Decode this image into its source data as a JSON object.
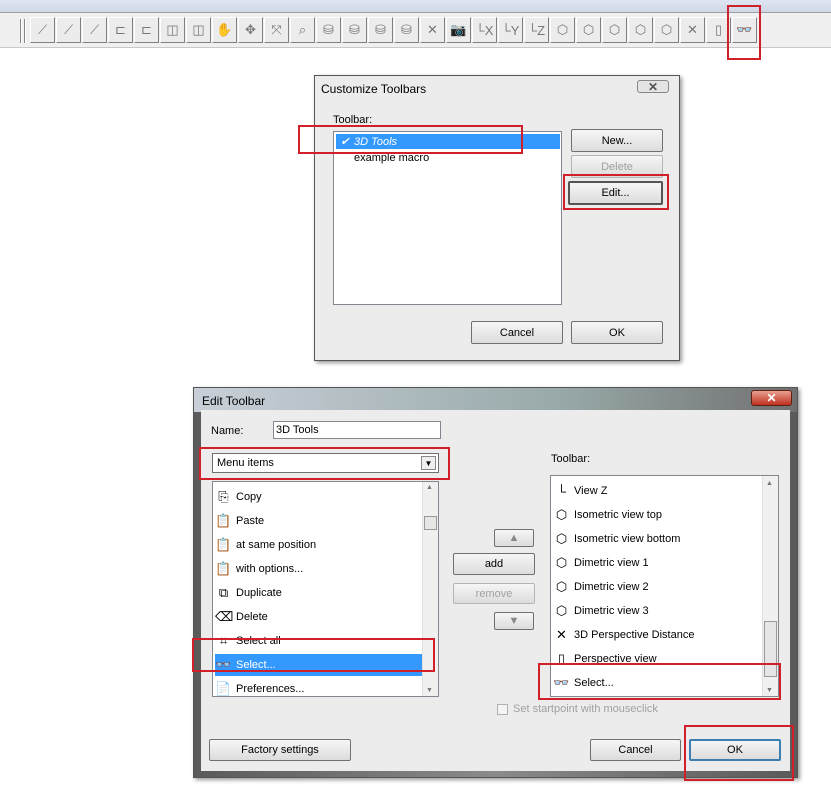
{
  "toolbar_icons": [
    "pointer-icon",
    "pointer-p-icon",
    "pointer-star-icon",
    "measure-rect-icon",
    "measure-curve-icon",
    "rect-shape-icon",
    "curve-shape-icon",
    "hand-pan-icon",
    "move-in-icon",
    "move-out-icon",
    "zoom-window-icon",
    "cylinder-icon",
    "cylinder-plain-icon",
    "cylinder-shaded-icon",
    "cylinder-solid-icon",
    "perspective-distance-icon",
    "camera-icon",
    "view-x-icon",
    "view-y-icon",
    "view-z-icon",
    "isometric-top-icon",
    "isometric-bottom-icon",
    "dimetric-1-icon",
    "dimetric-2-icon",
    "dimetric-3-icon",
    "perspective-distance-2-icon",
    "perspective-view-icon",
    "binoculars-icon"
  ],
  "toolbar_glyphs": [
    "⟋",
    "⟋",
    "⟋",
    "⊏",
    "⊏",
    "◫",
    "◫",
    "✋",
    "✥",
    "⤧",
    "⌕",
    "⛁",
    "⛁",
    "⛁",
    "⛁",
    "✕",
    "📷",
    "└X",
    "└Y",
    "└Z",
    "⬡",
    "⬡",
    "⬡",
    "⬡",
    "⬡",
    "✕",
    "▯",
    "👓"
  ],
  "customize": {
    "title": "Customize Toolbars",
    "toolbar_label": "Toolbar:",
    "items": [
      {
        "label": "3D Tools",
        "checked": true,
        "selected": true
      },
      {
        "label": "example macro",
        "checked": false,
        "selected": false
      }
    ],
    "check": "✔",
    "new": "New...",
    "delete": "Delete",
    "edit": "Edit...",
    "cancel": "Cancel",
    "ok": "OK"
  },
  "edit": {
    "title": "Edit Toolbar",
    "name_label": "Name:",
    "name_value": "3D Tools",
    "dropdown_value": "Menu items",
    "left_items": [
      {
        "label": "Copy",
        "icon": "copy-icon",
        "glyph": "⎘"
      },
      {
        "label": "Paste",
        "icon": "paste-icon",
        "glyph": "📋"
      },
      {
        "label": "at same position",
        "icon": "paste-same-position-icon",
        "glyph": "📋"
      },
      {
        "label": "with options...",
        "icon": "paste-options-icon",
        "glyph": "📋"
      },
      {
        "label": "Duplicate",
        "icon": "duplicate-icon",
        "glyph": "⧉"
      },
      {
        "label": "Delete",
        "icon": "eraser-icon",
        "glyph": "⌫"
      },
      {
        "label": "Select all",
        "icon": "select-all-icon",
        "glyph": "⌗"
      },
      {
        "label": "Select...",
        "icon": "binoculars-icon",
        "glyph": "👓",
        "selected": true
      },
      {
        "label": "Preferences...",
        "icon": "preferences-icon",
        "glyph": "📄"
      }
    ],
    "add": "add",
    "remove": "remove",
    "right_label": "Toolbar:",
    "right_items": [
      {
        "label": "View Z",
        "icon": "view-z-icon",
        "glyph": "└"
      },
      {
        "label": "Isometric view top",
        "icon": "isometric-top-icon",
        "glyph": "⬡"
      },
      {
        "label": "Isometric view bottom",
        "icon": "isometric-bottom-icon",
        "glyph": "⬡"
      },
      {
        "label": "Dimetric view 1",
        "icon": "dimetric-1-icon",
        "glyph": "⬡"
      },
      {
        "label": "Dimetric view 2",
        "icon": "dimetric-2-icon",
        "glyph": "⬡"
      },
      {
        "label": "Dimetric view 3",
        "icon": "dimetric-3-icon",
        "glyph": "⬡"
      },
      {
        "label": "3D Perspective Distance",
        "icon": "perspective-distance-icon",
        "glyph": "✕"
      },
      {
        "label": "Perspective view",
        "icon": "perspective-view-icon",
        "glyph": "▯"
      },
      {
        "label": "Select...",
        "icon": "binoculars-icon",
        "glyph": "👓"
      }
    ],
    "checkbox_label": "Set startpoint with mouseclick",
    "factory": "Factory settings",
    "cancel": "Cancel",
    "ok": "OK"
  },
  "colors": {
    "selection": "#3399ff",
    "highlight_box": "#d0202a"
  }
}
